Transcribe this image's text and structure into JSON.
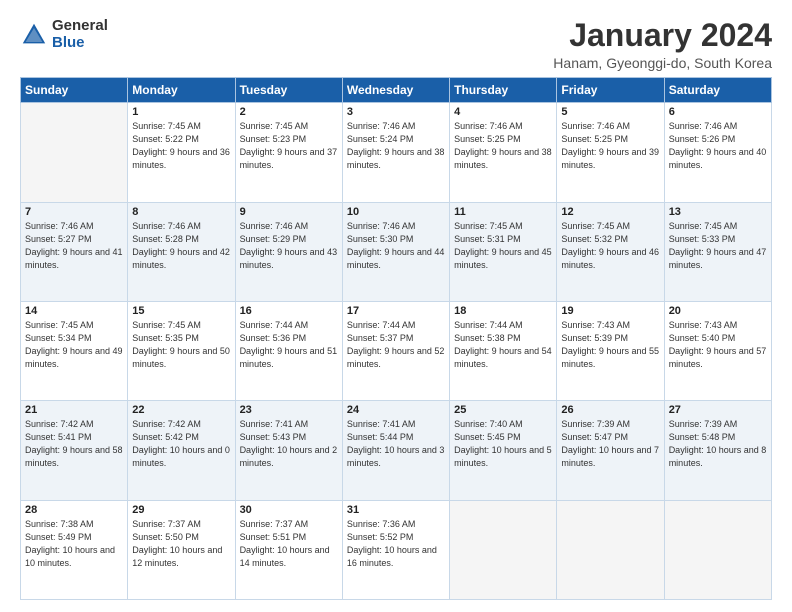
{
  "logo": {
    "general": "General",
    "blue": "Blue"
  },
  "header": {
    "title": "January 2024",
    "location": "Hanam, Gyeonggi-do, South Korea"
  },
  "weekdays": [
    "Sunday",
    "Monday",
    "Tuesday",
    "Wednesday",
    "Thursday",
    "Friday",
    "Saturday"
  ],
  "weeks": [
    [
      {
        "day": "",
        "empty": true
      },
      {
        "day": "1",
        "rise": "7:45 AM",
        "set": "5:22 PM",
        "hours": "9 hours and 36 minutes."
      },
      {
        "day": "2",
        "rise": "7:45 AM",
        "set": "5:23 PM",
        "hours": "9 hours and 37 minutes."
      },
      {
        "day": "3",
        "rise": "7:46 AM",
        "set": "5:24 PM",
        "hours": "9 hours and 38 minutes."
      },
      {
        "day": "4",
        "rise": "7:46 AM",
        "set": "5:25 PM",
        "hours": "9 hours and 38 minutes."
      },
      {
        "day": "5",
        "rise": "7:46 AM",
        "set": "5:25 PM",
        "hours": "9 hours and 39 minutes."
      },
      {
        "day": "6",
        "rise": "7:46 AM",
        "set": "5:26 PM",
        "hours": "9 hours and 40 minutes."
      }
    ],
    [
      {
        "day": "7",
        "rise": "7:46 AM",
        "set": "5:27 PM",
        "hours": "9 hours and 41 minutes."
      },
      {
        "day": "8",
        "rise": "7:46 AM",
        "set": "5:28 PM",
        "hours": "9 hours and 42 minutes."
      },
      {
        "day": "9",
        "rise": "7:46 AM",
        "set": "5:29 PM",
        "hours": "9 hours and 43 minutes."
      },
      {
        "day": "10",
        "rise": "7:46 AM",
        "set": "5:30 PM",
        "hours": "9 hours and 44 minutes."
      },
      {
        "day": "11",
        "rise": "7:45 AM",
        "set": "5:31 PM",
        "hours": "9 hours and 45 minutes."
      },
      {
        "day": "12",
        "rise": "7:45 AM",
        "set": "5:32 PM",
        "hours": "9 hours and 46 minutes."
      },
      {
        "day": "13",
        "rise": "7:45 AM",
        "set": "5:33 PM",
        "hours": "9 hours and 47 minutes."
      }
    ],
    [
      {
        "day": "14",
        "rise": "7:45 AM",
        "set": "5:34 PM",
        "hours": "9 hours and 49 minutes."
      },
      {
        "day": "15",
        "rise": "7:45 AM",
        "set": "5:35 PM",
        "hours": "9 hours and 50 minutes."
      },
      {
        "day": "16",
        "rise": "7:44 AM",
        "set": "5:36 PM",
        "hours": "9 hours and 51 minutes."
      },
      {
        "day": "17",
        "rise": "7:44 AM",
        "set": "5:37 PM",
        "hours": "9 hours and 52 minutes."
      },
      {
        "day": "18",
        "rise": "7:44 AM",
        "set": "5:38 PM",
        "hours": "9 hours and 54 minutes."
      },
      {
        "day": "19",
        "rise": "7:43 AM",
        "set": "5:39 PM",
        "hours": "9 hours and 55 minutes."
      },
      {
        "day": "20",
        "rise": "7:43 AM",
        "set": "5:40 PM",
        "hours": "9 hours and 57 minutes."
      }
    ],
    [
      {
        "day": "21",
        "rise": "7:42 AM",
        "set": "5:41 PM",
        "hours": "9 hours and 58 minutes."
      },
      {
        "day": "22",
        "rise": "7:42 AM",
        "set": "5:42 PM",
        "hours": "10 hours and 0 minutes."
      },
      {
        "day": "23",
        "rise": "7:41 AM",
        "set": "5:43 PM",
        "hours": "10 hours and 2 minutes."
      },
      {
        "day": "24",
        "rise": "7:41 AM",
        "set": "5:44 PM",
        "hours": "10 hours and 3 minutes."
      },
      {
        "day": "25",
        "rise": "7:40 AM",
        "set": "5:45 PM",
        "hours": "10 hours and 5 minutes."
      },
      {
        "day": "26",
        "rise": "7:39 AM",
        "set": "5:47 PM",
        "hours": "10 hours and 7 minutes."
      },
      {
        "day": "27",
        "rise": "7:39 AM",
        "set": "5:48 PM",
        "hours": "10 hours and 8 minutes."
      }
    ],
    [
      {
        "day": "28",
        "rise": "7:38 AM",
        "set": "5:49 PM",
        "hours": "10 hours and 10 minutes."
      },
      {
        "day": "29",
        "rise": "7:37 AM",
        "set": "5:50 PM",
        "hours": "10 hours and 12 minutes."
      },
      {
        "day": "30",
        "rise": "7:37 AM",
        "set": "5:51 PM",
        "hours": "10 hours and 14 minutes."
      },
      {
        "day": "31",
        "rise": "7:36 AM",
        "set": "5:52 PM",
        "hours": "10 hours and 16 minutes."
      },
      {
        "day": "",
        "empty": true
      },
      {
        "day": "",
        "empty": true
      },
      {
        "day": "",
        "empty": true
      }
    ]
  ]
}
